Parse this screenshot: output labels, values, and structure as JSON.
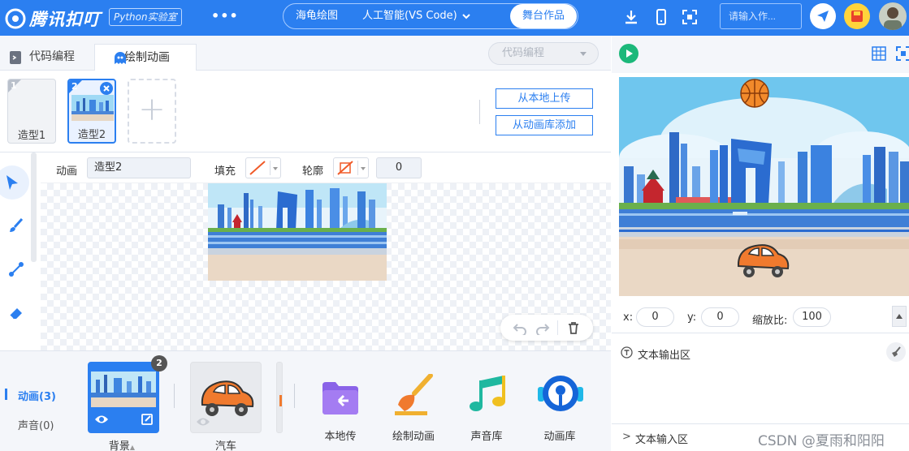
{
  "topbar": {
    "logo_text": "腾讯扣叮",
    "badge": "Python实验室",
    "more_label": "•••",
    "modes": [
      "海龟绘图",
      "人工智能(VS Code)",
      "舞台作品"
    ],
    "search_placeholder": "请输入作...",
    "accent_color": "#2b7ff0"
  },
  "left": {
    "tabs": [
      "代码编程",
      "绘制动画"
    ],
    "code_select": "代码编程",
    "costumes": [
      {
        "num": "1",
        "name": "造型1"
      },
      {
        "num": "2",
        "name": "造型2"
      }
    ],
    "add_icon": "+",
    "upload_local": "从本地上传",
    "add_from_library": "从动画库添加",
    "props": {
      "anim_label": "动画",
      "anim_value": "造型2",
      "fill_label": "填充",
      "outline_label": "轮廓",
      "outline_width": "0"
    },
    "tools": [
      "select-icon",
      "brush-icon",
      "reshape-icon",
      "eraser-icon"
    ]
  },
  "spritebar": {
    "sidetabs": [
      "动画(3)",
      "声音(0)"
    ],
    "sprites": [
      {
        "name": "背景",
        "badge": "2"
      },
      {
        "name": "汽车"
      }
    ],
    "library": [
      "本地传",
      "绘制动画",
      "声音库",
      "动画库"
    ]
  },
  "stage": {
    "x_label": "x:",
    "x_value": "0",
    "y_label": "y:",
    "y_value": "0",
    "scale_label": "缩放比:",
    "scale_value": "100",
    "output_title": "文本输出区",
    "input_title": "文本输入区",
    "input_prompt": ">",
    "watermark": "CSDN @夏雨和阳阳"
  }
}
